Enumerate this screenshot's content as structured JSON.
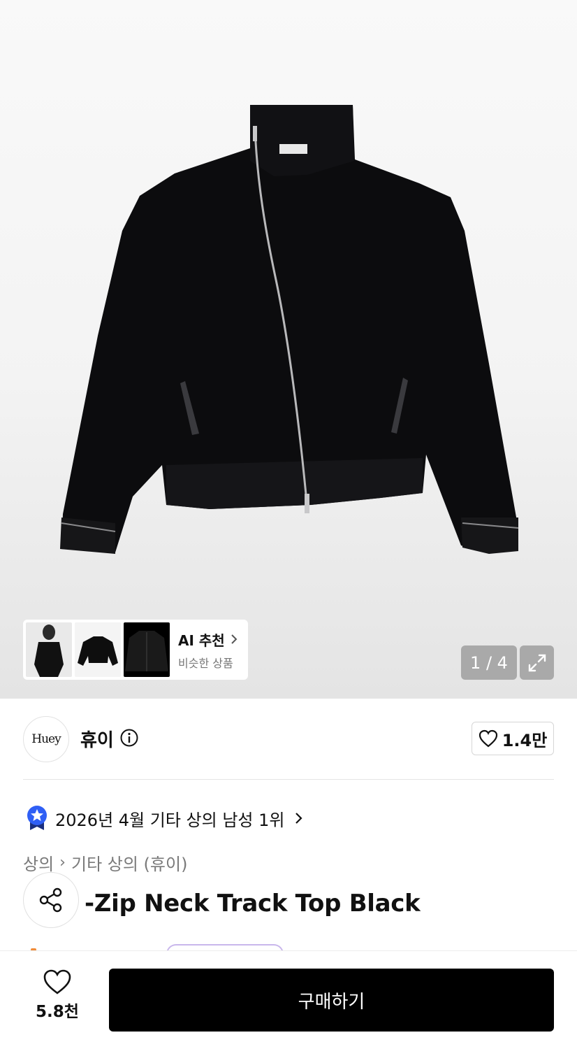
{
  "gallery": {
    "ai_title": "AI 추천",
    "ai_subtitle": "비슷한 상품",
    "counter": "1 / 4"
  },
  "brand": {
    "logo_text": "Huey",
    "name": "휴이",
    "likes": "1.4만"
  },
  "ranking": {
    "text": "2026년 4월 기타 상의 남성 1위"
  },
  "breadcrumb": {
    "category": "상의",
    "subcategory": "기타 상의 (휴이)"
  },
  "product": {
    "title_visible": "-Zip Neck Track Top Black"
  },
  "bottom": {
    "wish_count": "5.8천",
    "buy_label": "구매하기"
  },
  "colors": {
    "buy_button": "#000000",
    "rank_badge": "#2f5ff5",
    "overlay_button": "#a9a9a9"
  },
  "icons": [
    "info-icon",
    "heart-icon",
    "share-icon",
    "expand-icon",
    "chevron-right-icon",
    "star-badge-icon"
  ]
}
